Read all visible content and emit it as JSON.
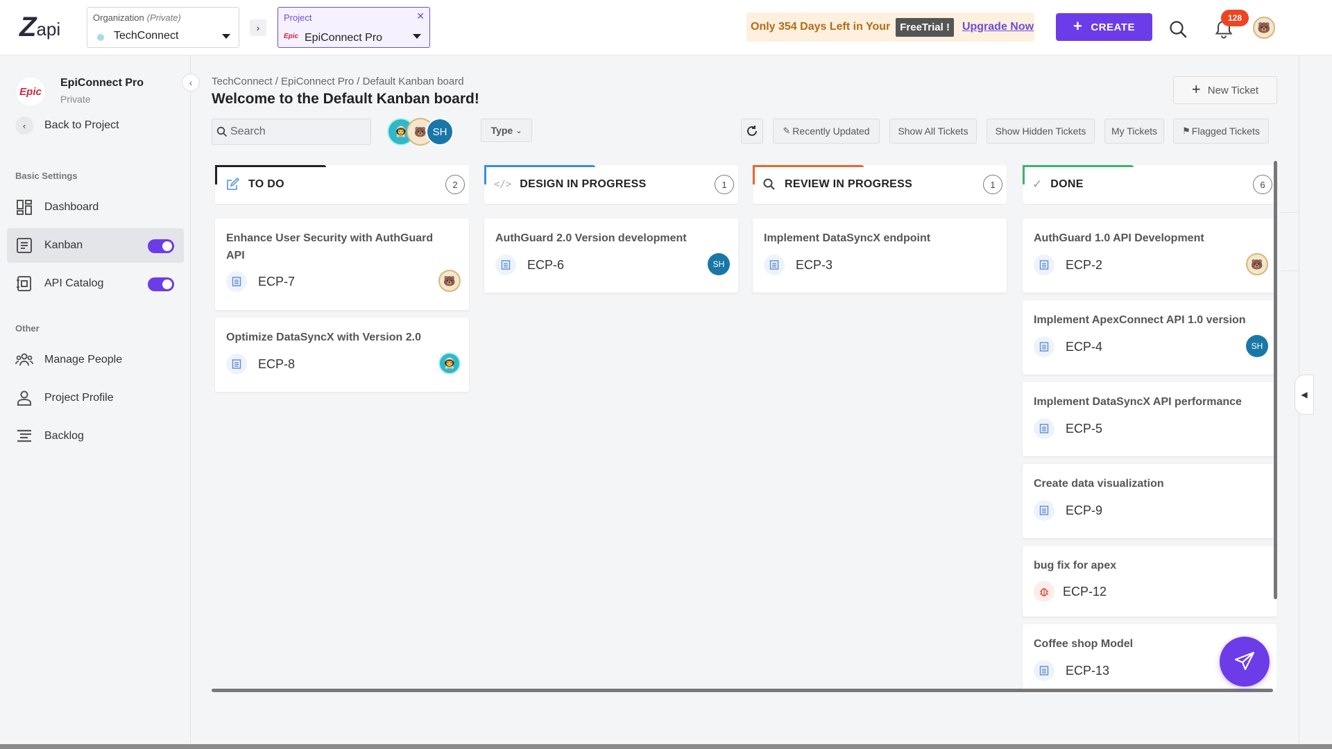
{
  "brand": {
    "logo_mark": "Z",
    "logo_text": "api"
  },
  "org": {
    "label": "Organization",
    "visibility": "(Private)",
    "value": "TechConnect"
  },
  "project_select": {
    "label": "Project",
    "value": "EpiConnect Pro",
    "logo": "Epic"
  },
  "trial": {
    "text": "Only 354 Days Left in Your",
    "badge": "FreeTrial !",
    "link": "Upgrade Now"
  },
  "create_label": "CREATE",
  "notifications": {
    "count": "128"
  },
  "sidebar": {
    "project_name": "EpiConnect Pro",
    "project_visibility": "Private",
    "project_logo": "Epic",
    "back_label": "Back to Project",
    "section_basic": "Basic Settings",
    "section_other": "Other",
    "items": [
      {
        "label": "Dashboard",
        "icon": "dashboard-icon"
      },
      {
        "label": "Kanban",
        "icon": "kanban-icon",
        "toggle": true
      },
      {
        "label": "API Catalog",
        "icon": "api-catalog-icon",
        "toggle": true
      },
      {
        "label": "Manage People",
        "icon": "people-icon"
      },
      {
        "label": "Project Profile",
        "icon": "person-icon"
      },
      {
        "label": "Backlog",
        "icon": "backlog-icon"
      }
    ]
  },
  "breadcrumb": "TechConnect / EpiConnect Pro / Default Kanban board",
  "page_title": "Welcome to the Default Kanban board!",
  "new_ticket_label": "New Ticket",
  "search": {
    "placeholder": "Search"
  },
  "avatar_initials": "SH",
  "type_filter": "Type",
  "filters": [
    "Recently Updated",
    "Show All Tickets",
    "Show Hidden Tickets",
    "My Tickets",
    "Flagged Tickets"
  ],
  "columns": [
    {
      "title": "TO DO",
      "count": "2",
      "color": "#222222",
      "cards": [
        {
          "title": "Enhance User Security with AuthGuard API",
          "key": "ECP-7",
          "assignee": "bear"
        },
        {
          "title": "Optimize DataSyncX with Version 2.0",
          "key": "ECP-8",
          "assignee": "astro"
        }
      ]
    },
    {
      "title": "DESIGN IN PROGRESS",
      "count": "1",
      "color": "#3a8fd9",
      "cards": [
        {
          "title": "AuthGuard 2.0 Version development",
          "key": "ECP-6",
          "assignee": "SH"
        }
      ]
    },
    {
      "title": "REVIEW IN PROGRESS",
      "count": "1",
      "color": "#e8672c",
      "cards": [
        {
          "title": "Implement DataSyncX endpoint",
          "key": "ECP-3"
        }
      ]
    },
    {
      "title": "DONE",
      "count": "6",
      "color": "#3db36b",
      "cards": [
        {
          "title": "AuthGuard 1.0 API Development",
          "key": "ECP-2",
          "assignee": "bear"
        },
        {
          "title": "Implement ApexConnect API 1.0 version",
          "key": "ECP-4",
          "assignee": "SH"
        },
        {
          "title": "Implement DataSyncX API performance",
          "key": "ECP-5"
        },
        {
          "title": "Create data visualization",
          "key": "ECP-9"
        },
        {
          "title": "bug fix for apex",
          "key": "ECP-12",
          "type": "bug"
        },
        {
          "title": "Coffee shop Model",
          "key": "ECP-13"
        }
      ]
    }
  ],
  "colors": {
    "accent": "#6c3ce9",
    "badge": "#ef4423",
    "trial_text": "#b36b16"
  }
}
